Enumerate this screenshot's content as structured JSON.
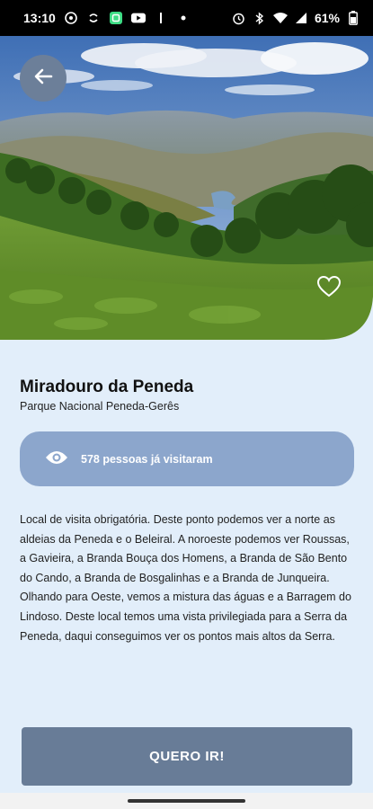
{
  "status_bar": {
    "time": "13:10",
    "battery": "61%",
    "icons": [
      "messenger-icon",
      "sync-icon",
      "app-icon",
      "youtube-icon",
      "dot-icon",
      "alarm-icon",
      "bluetooth-icon",
      "wifi-icon",
      "signal-icon",
      "battery-icon"
    ]
  },
  "place": {
    "title": "Miradouro da Peneda",
    "subtitle": "Parque Nacional Peneda-Gerês"
  },
  "visits": {
    "text": "578 pessoas já visitaram",
    "icon": "eye-icon"
  },
  "description": "Local de visita obrigatória. Deste ponto podemos ver a norte as aldeias da Peneda e o Beleiral. A noroeste podemos ver Roussas, a Gavieira, a Branda Bouça dos Homens, a Branda de São Bento do Cando, a Branda de Bosgalinhas e a Branda de Junqueira. Olhando para Oeste, vemos a mistura das águas e a Barragem do Lindoso. Deste local temos uma vista privilegiada para a Serra da Peneda, daqui conseguimos ver os pontos mais altos da Serra.",
  "actions": {
    "back_icon": "arrow-left-icon",
    "favorite_icon": "heart-outline-icon",
    "cta_label": "QUERO IR!"
  },
  "colors": {
    "background": "#e2eefa",
    "accent": "#8ca6cc",
    "button": "#687c97"
  }
}
